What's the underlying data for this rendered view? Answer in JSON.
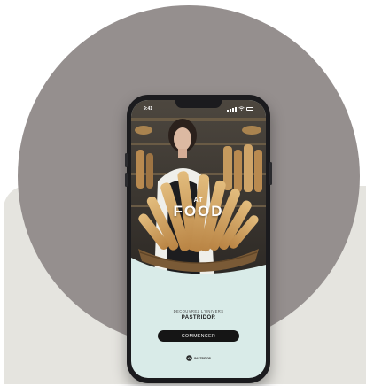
{
  "colors": {
    "circle": "#958f8e",
    "card": "#e5e4df",
    "screen_panel": "#d9ebe8",
    "button": "#151515"
  },
  "status_bar": {
    "time": "9:41"
  },
  "app": {
    "logo_top": "AT",
    "logo_main": "FOOD",
    "tagline": "DECOUVREZ L'UNIVERS",
    "brand": "PASTRIDOR",
    "cta_label": "COMMENCER",
    "footer_brand": "PASTRIDOR"
  },
  "icons": {
    "signal": "signal-icon",
    "wifi": "wifi-icon",
    "battery": "battery-icon",
    "footer": "pastridor-logo-icon"
  }
}
